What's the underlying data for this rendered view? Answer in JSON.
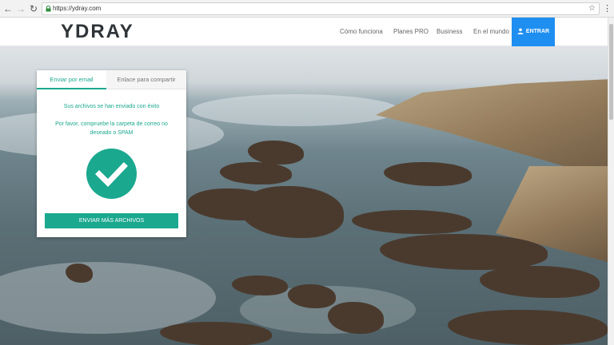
{
  "browser": {
    "url": "https://ydray.com",
    "icons": [
      "back-arrow-icon",
      "forward-arrow-icon",
      "reload-icon",
      "lock-icon",
      "star-icon",
      "menu-dots-icon"
    ]
  },
  "header": {
    "logo": "YDRAY",
    "nav": [
      "Cómo funciona",
      "Planes PRO",
      "Business",
      "En el mundo"
    ],
    "login_label": "ENTRAR",
    "accent_color": "#1f8ef1"
  },
  "card": {
    "tabs": [
      "Enviar por email",
      "Enlace para compartir"
    ],
    "active_tab": "Enviar por email",
    "success_message": "Sus archivos se han enviado con éxito",
    "spam_note": "Por favor, compruebe la carpeta de correo no deseado o SPAM",
    "send_more_label": "ENVIAR MÁS ARCHIVOS",
    "accent_color": "#1aa88f"
  }
}
